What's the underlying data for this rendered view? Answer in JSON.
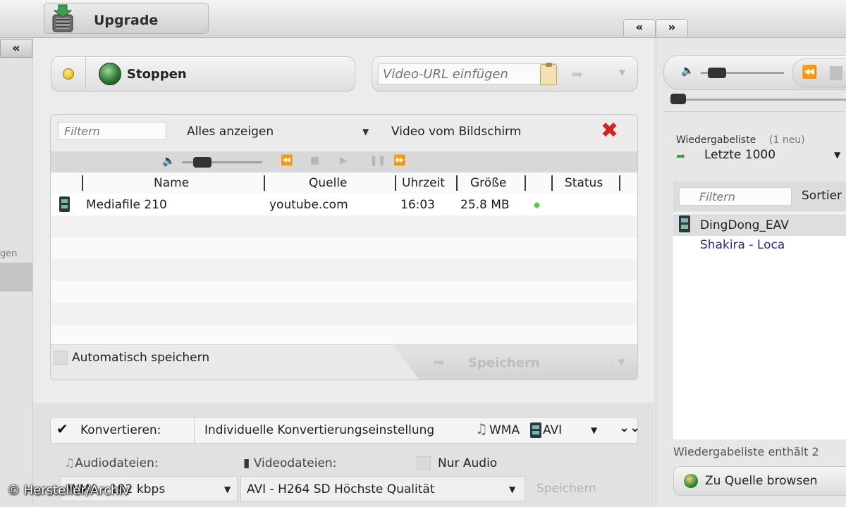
{
  "topbar": {
    "upgrade_label": "Upgrade",
    "nav_prev": "«",
    "nav_next": "»"
  },
  "left": {
    "collapse": "«",
    "partial_label": "gen"
  },
  "stop_panel": {
    "label": "Stoppen"
  },
  "url_panel": {
    "placeholder": "Video-URL einfügen"
  },
  "list": {
    "filter_placeholder": "Filtern",
    "show_all": "Alles anzeigen",
    "video_from_screen": "Video vom Bildschirm",
    "columns": [
      "Name",
      "Quelle",
      "Uhrzeit",
      "Größe",
      "",
      "Status"
    ],
    "rows": [
      {
        "name": "Mediafile 210",
        "source": "youtube.com",
        "time": "16:03",
        "size": "25.8 MB",
        "status": ""
      }
    ],
    "auto_save": "Automatisch speichern",
    "save": "Speichern"
  },
  "convert": {
    "label": "Konvertieren:",
    "checked": true,
    "setting": "Individuelle Konvertierungseinstellung",
    "audio_format": "WMA",
    "video_format": "AVI",
    "audio_files_label": "Audiodateien:",
    "video_files_label": "Videodateien:",
    "audio_only_label": "Nur Audio",
    "audio_select": "WMA - 192 kbps",
    "video_select": "AVI - H264 SD Höchste Qualität",
    "save": "Speichern"
  },
  "right_panel": {
    "playlist_label": "Wiedergabeliste",
    "playlist_new": "(1 neu)",
    "playlist_name": "Letzte 1000",
    "filter_placeholder": "Filtern",
    "sort_label": "Sortier",
    "items": [
      "DingDong_EAV",
      "Shakira - Loca"
    ],
    "footer": "Wiedergabeliste enthält 2",
    "browse": "Zu Quelle browsen"
  },
  "watermark": "© Hersteller/Archiv",
  "icons": [
    "upgrade-icon",
    "globe-icon",
    "clipboard-icon",
    "close-icon",
    "volume-icon",
    "film-icon",
    "music-note-icon",
    "arrow-right-icon",
    "expand-down-icon",
    "playlist-icon",
    "browse-icon"
  ],
  "colors": {
    "close": "#d42323",
    "status_ok": "#54d040",
    "link_item": "#2a2a8c"
  }
}
